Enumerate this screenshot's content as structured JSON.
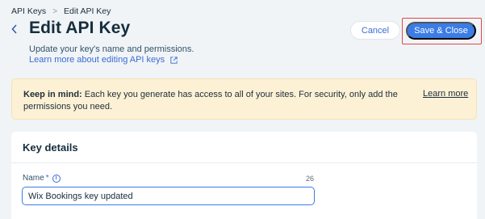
{
  "breadcrumb": {
    "items": [
      "API Keys",
      "Edit API Key"
    ],
    "separator": ">"
  },
  "header": {
    "title": "Edit API Key",
    "subtitle": "Update your key's name and permissions.",
    "learn_link": "Learn more about editing API keys"
  },
  "actions": {
    "cancel_label": "Cancel",
    "save_label": "Save & Close"
  },
  "notice": {
    "bold": "Keep in mind:",
    "text": " Each key you generate has access to all of your sites. For security, only add the permissions you need.",
    "learn_more": "Learn more"
  },
  "key_details": {
    "title": "Key details",
    "name_label": "Name",
    "required_mark": "*",
    "char_count": "26",
    "name_value": "Wix Bookings key updated"
  },
  "icons": {
    "back": "chevron-left-icon",
    "external": "external-link-icon",
    "info": "info-icon"
  },
  "colors": {
    "accent": "#3b7ce6",
    "link": "#3b6bd6",
    "highlight": "#e8454b",
    "notice_bg": "#fdf1d5"
  }
}
